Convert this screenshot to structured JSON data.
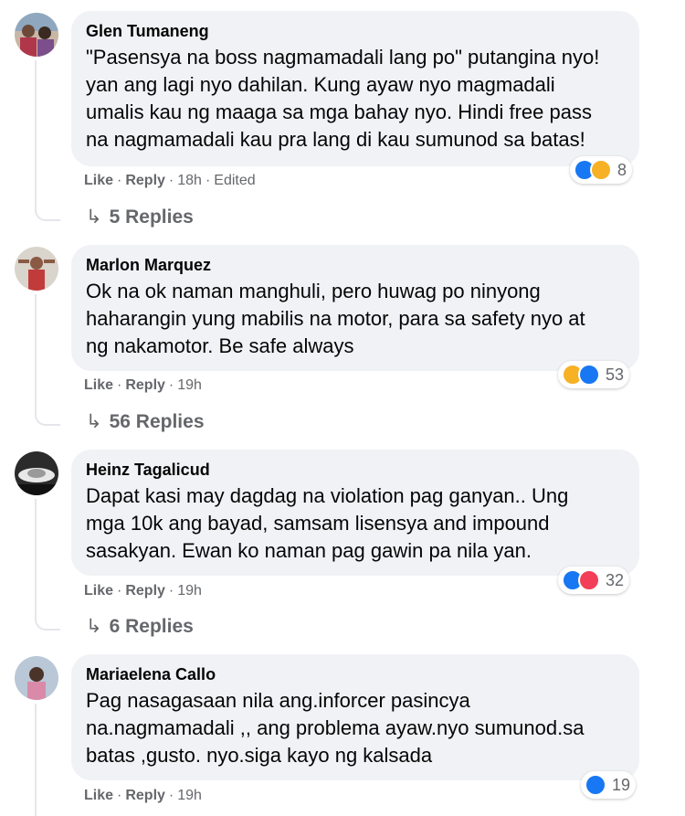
{
  "comments": [
    {
      "author": "Glen Tumaneng",
      "lines": [
        "\"Pasensya na boss nagmamadali lang po\" putangina nyo!",
        "yan ang lagi nyo dahilan. Kung ayaw nyo magmadali",
        "umalis kau ng maaga sa mga bahay nyo. Hindi free pass",
        "na nagmamadali kau pra lang di kau sumunod sa batas!"
      ],
      "like_label": "Like",
      "reply_label": "Reply",
      "time": "18h",
      "edited": "Edited",
      "reactions": [
        "like-icon",
        "haha-icon"
      ],
      "reaction_count": "8",
      "replies": "5 Replies"
    },
    {
      "author": "Marlon Marquez",
      "lines": [
        "Ok na ok naman manghuli, pero huwag po ninyong",
        "haharangin yung mabilis na motor, para sa safety nyo at",
        "ng nakamotor. Be safe always"
      ],
      "like_label": "Like",
      "reply_label": "Reply",
      "time": "19h",
      "reactions": [
        "haha-icon",
        "like-icon"
      ],
      "reaction_count": "53",
      "replies": "56 Replies"
    },
    {
      "author": "Heinz Tagalicud",
      "lines": [
        "Dapat kasi may dagdag na violation pag ganyan.. Ung",
        "mga 10k ang bayad, samsam lisensya and impound",
        "sasakyan. Ewan ko naman pag gawin pa nila yan."
      ],
      "like_label": "Like",
      "reply_label": "Reply",
      "time": "19h",
      "reactions": [
        "like-icon",
        "love-icon"
      ],
      "reaction_count": "32",
      "replies": "6 Replies"
    },
    {
      "author": "Mariaelena Callo",
      "lines": [
        "Pag nasagasaan nila ang.inforcer pasincya",
        "na.nagmamadali ,, ang problema ayaw.nyo sumunod.sa",
        "batas ,gusto. nyo.siga kayo ng kalsada"
      ],
      "like_label": "Like",
      "reply_label": "Reply",
      "time": "19h",
      "reactions": [
        "like-icon"
      ],
      "reaction_count": "19"
    }
  ],
  "colors": {
    "bubble": "#f0f2f5",
    "secondary_text": "#65676b",
    "like_blue": "#1877f2",
    "haha_yellow": "#f7b125",
    "love_red": "#f33e58"
  }
}
